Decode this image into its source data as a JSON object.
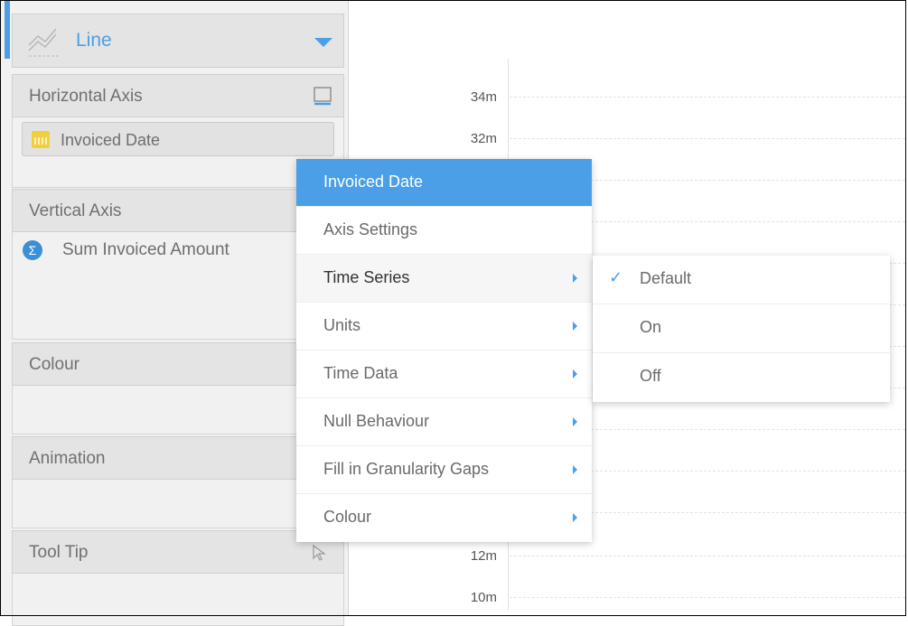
{
  "chart_picker": {
    "label": "Line",
    "icon": "line-chart-icon"
  },
  "panels": {
    "horizontal_axis": {
      "title": "Horizontal Axis",
      "field": "Invoiced Date",
      "field_icon": "calendar-icon"
    },
    "vertical_axis": {
      "title": "Vertical Axis",
      "field": "Sum Invoiced Amount",
      "field_icon": "sigma-icon"
    },
    "colour": {
      "title": "Colour"
    },
    "animation": {
      "title": "Animation"
    },
    "tooltip": {
      "title": "Tool Tip"
    }
  },
  "axis_ticks": [
    "34m",
    "32m",
    "12m",
    "10m"
  ],
  "context_menu": {
    "header": "Invoiced Date",
    "items": [
      {
        "label": "Axis Settings",
        "submenu": false
      },
      {
        "label": "Time Series",
        "submenu": true
      },
      {
        "label": "Units",
        "submenu": true
      },
      {
        "label": "Time Data",
        "submenu": true
      },
      {
        "label": "Null Behaviour",
        "submenu": true
      },
      {
        "label": "Fill in Granularity Gaps",
        "submenu": true
      },
      {
        "label": "Colour",
        "submenu": true
      }
    ]
  },
  "submenu": {
    "items": [
      {
        "label": "Default",
        "checked": true
      },
      {
        "label": "On",
        "checked": false
      },
      {
        "label": "Off",
        "checked": false
      }
    ]
  },
  "colors": {
    "accent": "#4a9fe6",
    "calendar": "#f2cf3d"
  }
}
